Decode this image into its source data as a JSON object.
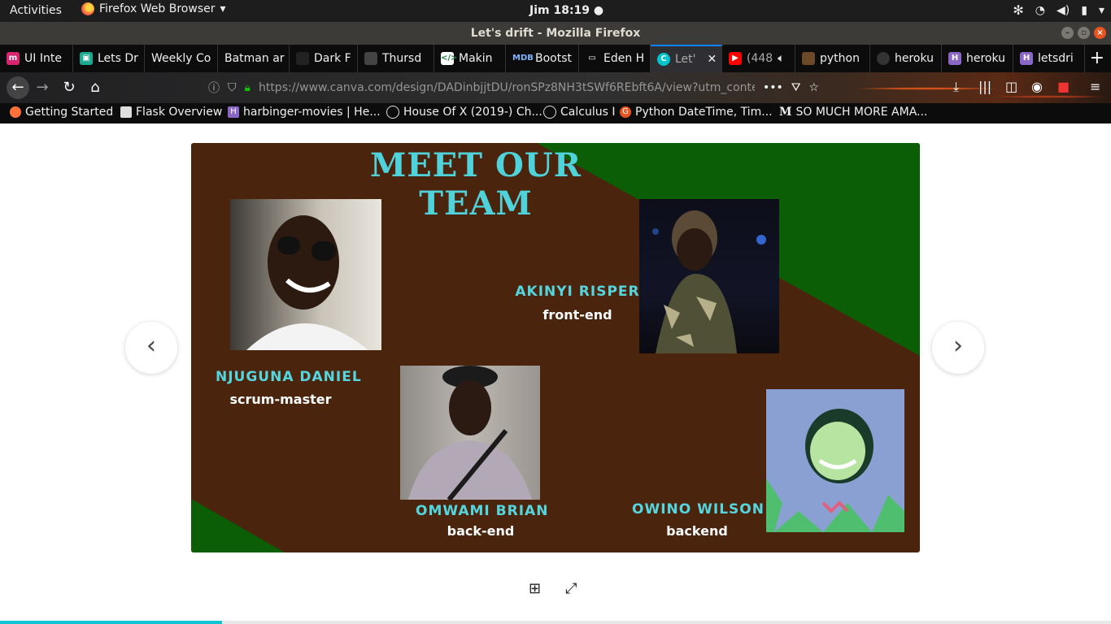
{
  "topbar": {
    "activities": "Activities",
    "app_name": "Firefox Web Browser",
    "clock": "Jim 18:19"
  },
  "window": {
    "title": "Let's drift - Mozilla Firefox"
  },
  "tabs": [
    {
      "label": "UI Inte",
      "icon_color": "#d6246e",
      "icon_letter": "m"
    },
    {
      "label": "Lets Dr",
      "icon_color": "#1ba98f",
      "icon_letter": "▣"
    },
    {
      "label": "Weekly Co",
      "icon_color": "",
      "icon_letter": ""
    },
    {
      "label": "Batman ar",
      "icon_color": "",
      "icon_letter": ""
    },
    {
      "label": "Dark F",
      "icon_color": "#222222",
      "icon_letter": "■"
    },
    {
      "label": "Thursd",
      "icon_color": "#444444",
      "icon_letter": "·"
    },
    {
      "label": "Makin",
      "icon_color": "#ffffff",
      "icon_letter": "</>"
    },
    {
      "label": "Bootst",
      "icon_color": "#1266f1",
      "icon_letter": "MD"
    },
    {
      "label": "Eden H",
      "icon_color": "#555555",
      "icon_letter": "▭"
    },
    {
      "label": "Let'",
      "icon_color": "#00c4cc",
      "icon_letter": "C"
    },
    {
      "label": "(448",
      "icon_color": "#ff0000",
      "icon_letter": "▶"
    },
    {
      "label": "python",
      "icon_color": "#6b4a2a",
      "icon_letter": "♨"
    },
    {
      "label": "heroku",
      "icon_color": "#333333",
      "icon_letter": "●"
    },
    {
      "label": "heroku",
      "icon_color": "#8a66c7",
      "icon_letter": "H"
    },
    {
      "label": "letsdri",
      "icon_color": "#8a66c7",
      "icon_letter": "H"
    }
  ],
  "navbar": {
    "url": "https://www.canva.com/design/DADinbjjtDU/ronSPz8NH3tSWf6REbft6A/view?utm_conten"
  },
  "bookmarks": [
    {
      "label": "Getting Started",
      "icon_color": "#ff7139"
    },
    {
      "label": "Flask Overview",
      "icon_color": "#dddddd"
    },
    {
      "label": "harbinger-movies | He...",
      "icon_color": "#8a66c7"
    },
    {
      "label": "House Of X (2019-) Ch...",
      "icon_color": "#888888"
    },
    {
      "label": "Calculus I",
      "icon_color": "#888888"
    },
    {
      "label": "Python DateTime, Tim...",
      "icon_color": "#e95420"
    },
    {
      "label": "SO MUCH MORE AMA...",
      "icon_color": "#111111"
    }
  ],
  "slide": {
    "title": "MEET OUR TEAM",
    "colors": {
      "background": "#4b240d",
      "accent_green": "#0b5e05",
      "name_color": "#55d6df"
    },
    "members": [
      {
        "name": "NJUGUNA DANIEL",
        "role": "scrum-master"
      },
      {
        "name": "AKINYI RISPER",
        "role": "front-end"
      },
      {
        "name": "OMWAMI BRIAN",
        "role": "back-end"
      },
      {
        "name": "OWINO WILSON",
        "role": "backend"
      }
    ]
  },
  "presentation": {
    "progress_fraction": 0.2
  }
}
